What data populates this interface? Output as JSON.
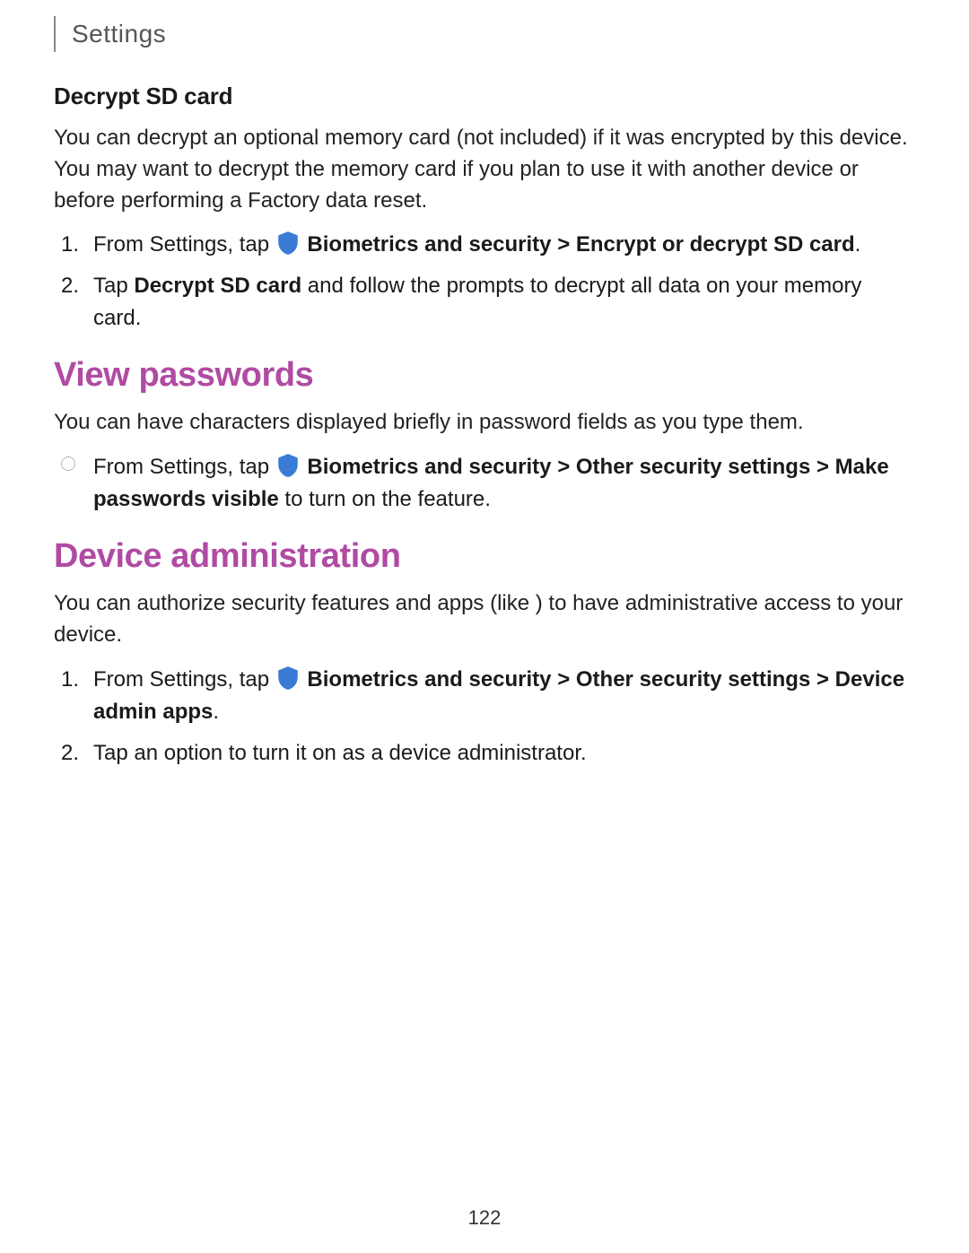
{
  "header": {
    "breadcrumb": "Settings"
  },
  "sections": {
    "decrypt": {
      "title": "Decrypt SD card",
      "intro": "You can decrypt an optional memory card (not included) if it was encrypted by this device. You may want to decrypt the memory card if you plan to use it with another device or before performing a Factory data reset.",
      "step1_prefix": "From Settings, tap ",
      "step1_bold1": "Biometrics and security",
      "step1_sep": " > ",
      "step1_bold2": "Encrypt or decrypt SD card",
      "step1_suffix": ".",
      "step2_prefix": "Tap ",
      "step2_bold": "Decrypt SD card",
      "step2_suffix": " and follow the prompts to decrypt all data on your memory card."
    },
    "view_passwords": {
      "title": "View passwords",
      "intro": "You can have characters displayed briefly in password fields as you type them.",
      "bullet_prefix": "From Settings, tap ",
      "bullet_bold1": "Biometrics and security",
      "bullet_sep1": " > ",
      "bullet_bold2": "Other security settings",
      "bullet_sep2": " > ",
      "bullet_bold3": "Make passwords visible",
      "bullet_suffix": " to turn on the feature."
    },
    "device_admin": {
      "title": "Device administration",
      "intro": "You can authorize security features and apps (like ) to have administrative access to your device.",
      "step1_prefix": "From Settings, tap ",
      "step1_bold1": "Biometrics and security",
      "step1_sep1": " > ",
      "step1_bold2": "Other security settings",
      "step1_sep2": " > ",
      "step1_bold3": "Device admin apps",
      "step1_suffix": ".",
      "step2": "Tap an option to turn it on as a device administrator."
    }
  },
  "icons": {
    "shield": "shield-icon"
  },
  "page_number": "122"
}
